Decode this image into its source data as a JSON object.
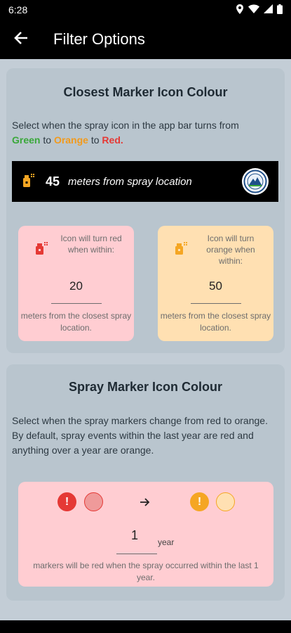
{
  "status_bar": {
    "time": "6:28",
    "icons": [
      "location-icon",
      "wifi-icon",
      "signal-icon",
      "battery-icon"
    ]
  },
  "app_bar": {
    "title": "Filter Options",
    "back_icon": "arrow-left-icon"
  },
  "closest_marker": {
    "title": "Closest Marker Icon Colour",
    "description_prefix": "Select when the spray icon in the app bar turns from",
    "green": "Green",
    "to1": " to ",
    "orange": "Orange",
    "to2": " to ",
    "red": "Red.",
    "distance": {
      "value": "45",
      "text": "meters from spray location"
    },
    "red_threshold": {
      "hint": "Icon will turn red when within:",
      "value": "20",
      "footer": "meters from the closest spray location."
    },
    "orange_threshold": {
      "hint": "Icon will turn orange when within:",
      "value": "50",
      "footer": "meters from the closest spray location."
    }
  },
  "spray_marker": {
    "title": "Spray Marker Icon Colour",
    "description": "Select when the spray markers change from red to orange. By default, spray events within the last year are red and anything over a year are orange.",
    "marker_symbol": "!",
    "years_value": "1",
    "years_unit": "year",
    "footer": "markers will be red when the spray occurred within the last 1 year."
  },
  "colors": {
    "red": "#e53935",
    "orange": "#f5a623",
    "green": "#3aa83a"
  }
}
